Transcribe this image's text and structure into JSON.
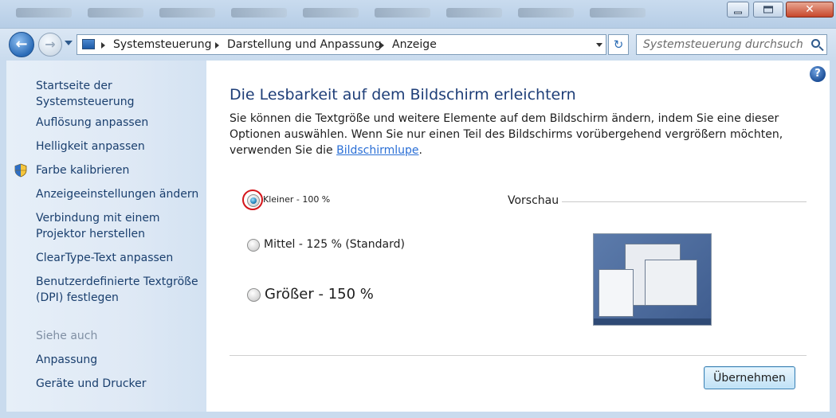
{
  "window": {
    "minimize_glyph": "",
    "close_glyph": "✕"
  },
  "nav": {
    "back_glyph": "←",
    "forward_glyph": "→",
    "refresh_glyph": "↻"
  },
  "breadcrumb": [
    "Systemsteuerung",
    "Darstellung und Anpassung",
    "Anzeige"
  ],
  "search": {
    "placeholder": "Systemsteuerung durchsuchen"
  },
  "sidebar": {
    "home": "Startseite der Systemsteuerung",
    "items": [
      {
        "label": "Auflösung anpassen"
      },
      {
        "label": "Helligkeit anpassen"
      },
      {
        "label": "Farbe kalibrieren",
        "icon": "shield-icon"
      },
      {
        "label": "Anzeigeeinstellungen ändern"
      },
      {
        "label": "Verbindung mit einem Projektor herstellen"
      },
      {
        "label": "ClearType-Text anpassen"
      },
      {
        "label": "Benutzerdefinierte Textgröße (DPI) festlegen"
      }
    ],
    "see_also_heading": "Siehe auch",
    "see_also": [
      {
        "label": "Anpassung"
      },
      {
        "label": "Geräte und Drucker"
      }
    ]
  },
  "main": {
    "help_glyph": "?",
    "heading": "Die Lesbarkeit auf dem Bildschirm erleichtern",
    "description_part1": "Sie können die Textgröße und weitere Elemente auf dem Bildschirm ändern, indem Sie eine dieser Optionen auswählen. Wenn Sie nur einen Teil des Bildschirms vorübergehend vergrößern möchten, verwenden Sie die ",
    "description_link": "Bildschirmlupe",
    "description_end": ".",
    "options": [
      {
        "label": "Kleiner - 100 %",
        "checked": true
      },
      {
        "label": "Mittel - 125 % (Standard)",
        "checked": false
      },
      {
        "label": "Größer - 150 %",
        "checked": false
      }
    ],
    "preview_label": "Vorschau",
    "apply_label": "Übernehmen"
  },
  "colors": {
    "heading": "#1e3e78",
    "link": "#2a6fd6",
    "highlight_ring": "#d4161b"
  }
}
